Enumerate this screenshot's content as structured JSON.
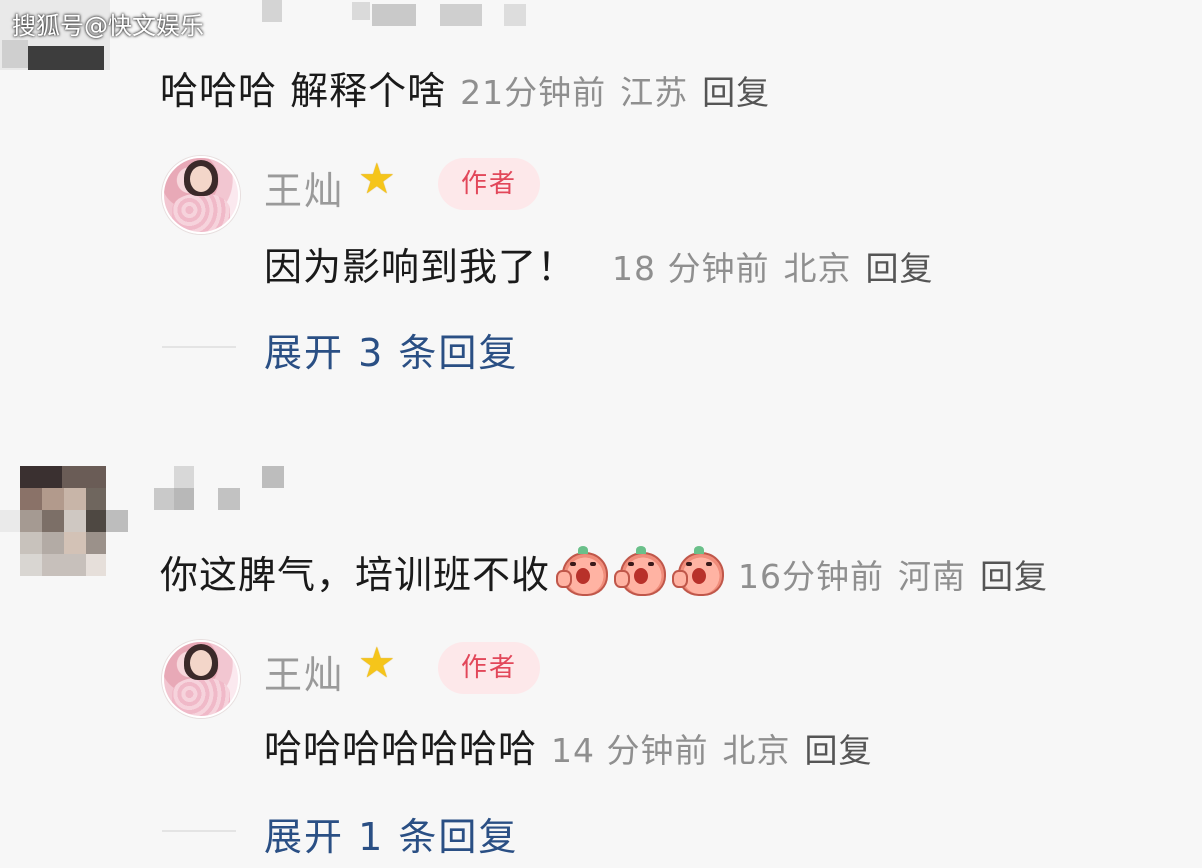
{
  "watermark": "搜狐号@快文娱乐",
  "comments": [
    {
      "text": "哈哈哈 解释个啥",
      "time": "21分钟前",
      "location": "江苏",
      "reply_label": "回复"
    },
    {
      "text": "你这脾气，培训班不收",
      "emoji_count": 3,
      "time": "16分钟前",
      "location": "河南",
      "reply_label": "回复"
    }
  ],
  "author_replies": [
    {
      "name": "王灿",
      "badge": "作者",
      "text": "因为影响到我了！",
      "time": "18 分钟前",
      "location": "北京",
      "reply_label": "回复",
      "expand_label": "展开 3 条回复"
    },
    {
      "name": "王灿",
      "badge": "作者",
      "text": "哈哈哈哈哈哈哈",
      "time": "14 分钟前",
      "location": "北京",
      "reply_label": "回复",
      "expand_label": "展开 1 条回复"
    }
  ],
  "icons": {
    "verified": "star-icon",
    "emoji": "crying-face-emoji-icon"
  },
  "colors": {
    "background": "#f7f7f7",
    "author_badge_bg": "#fde8ea",
    "author_badge_text": "#e2475a",
    "expand_link": "#2a4f84",
    "meta_text": "#8f8f8f"
  }
}
